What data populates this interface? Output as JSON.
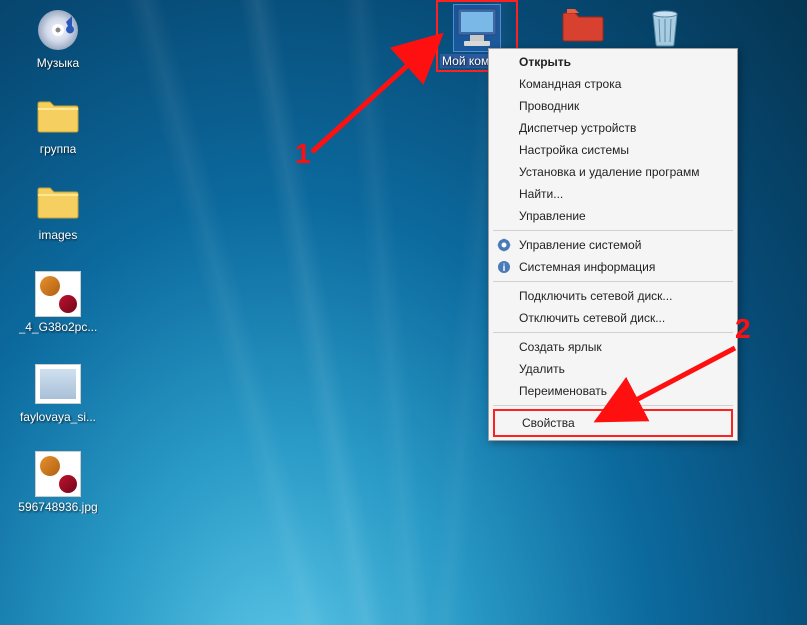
{
  "desktop_icons": {
    "music": {
      "label": "Музыка"
    },
    "group": {
      "label": "группа"
    },
    "images": {
      "label": "images"
    },
    "file1": {
      "label": "_4_G38o2pc..."
    },
    "file2": {
      "label": "faylovaya_si..."
    },
    "file3": {
      "label": "596748936.jpg"
    },
    "mycomputer": {
      "label": "Мой компь..."
    },
    "redfolder": {
      "label": ""
    },
    "recycle": {
      "label": ""
    }
  },
  "context_menu": {
    "open": "Открыть",
    "cmd": "Командная строка",
    "explorer": "Проводник",
    "devmgr": "Диспетчер устройств",
    "sysconfig": "Настройка системы",
    "addremove": "Установка и удаление программ",
    "find": "Найти...",
    "manage": "Управление",
    "sysmanage": "Управление системой",
    "sysinfo": "Системная информация",
    "mapdrive": "Подключить сетевой диск...",
    "unmapdrive": "Отключить сетевой диск...",
    "shortcut": "Создать ярлык",
    "delete": "Удалить",
    "rename": "Переименовать",
    "properties": "Свойства"
  },
  "annotations": {
    "one": "1",
    "two": "2"
  }
}
